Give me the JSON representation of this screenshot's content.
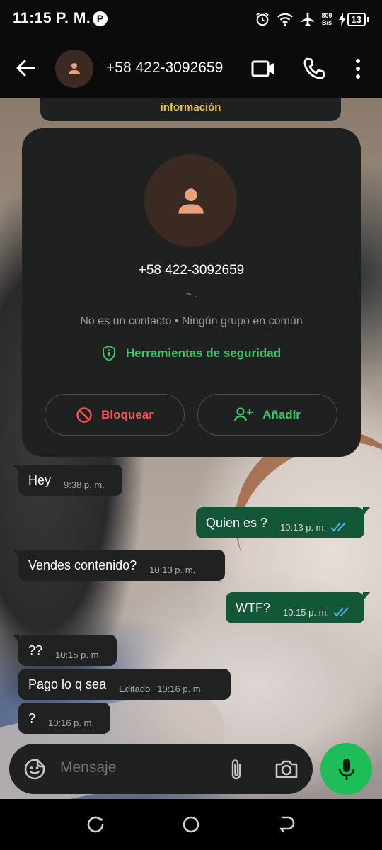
{
  "status_bar": {
    "time": "11:15 P. M.",
    "pinterest_glyph": "P",
    "net_speed_value": "809",
    "net_speed_unit": "B/s",
    "battery_level": "13",
    "icons": [
      "alarm-icon",
      "wifi-icon",
      "airplane-mode-icon",
      "charging-icon",
      "battery-icon"
    ]
  },
  "header": {
    "contact_name": "+58 422-3092659",
    "icons": [
      "back-arrow-icon",
      "avatar-person-icon",
      "video-call-icon",
      "voice-call-icon",
      "more-vert-icon"
    ]
  },
  "banner": {
    "text": "información"
  },
  "contact_card": {
    "name": "+58 422-3092659",
    "alias": "~ .",
    "info": "No es un contacto • Ningún grupo en común",
    "security_label": "Herramientas de seguridad",
    "block_label": "Bloquear",
    "add_label": "Añadir"
  },
  "messages": [
    {
      "direction": "in",
      "text": "Hey",
      "time": "9:38 p. m."
    },
    {
      "direction": "out",
      "text": "Quien es ?",
      "time": "10:13 p. m.",
      "status": "read"
    },
    {
      "direction": "in",
      "text": "Vendes contenido?",
      "time": "10:13 p. m."
    },
    {
      "direction": "out",
      "text": "WTF?",
      "time": "10:15 p. m.",
      "status": "read"
    },
    {
      "direction": "in",
      "text": "??",
      "time": "10:15 p. m."
    },
    {
      "direction": "in",
      "text": "Pago lo q sea",
      "time": "10:16 p. m.",
      "edited_label": "Editado"
    },
    {
      "direction": "in",
      "text": "?",
      "time": "10:16 p. m."
    }
  ],
  "composer": {
    "placeholder": "Mensaje",
    "icons": [
      "sticker-icon",
      "attach-clip-icon",
      "camera-icon",
      "mic-icon"
    ]
  },
  "colors": {
    "accent_green": "#1fbc5a",
    "outgoing_bubble": "#135638",
    "incoming_bubble": "#202222",
    "danger_red": "#f2545b",
    "read_ticks": "#53bdeb",
    "banner_text": "#e8c34a"
  }
}
